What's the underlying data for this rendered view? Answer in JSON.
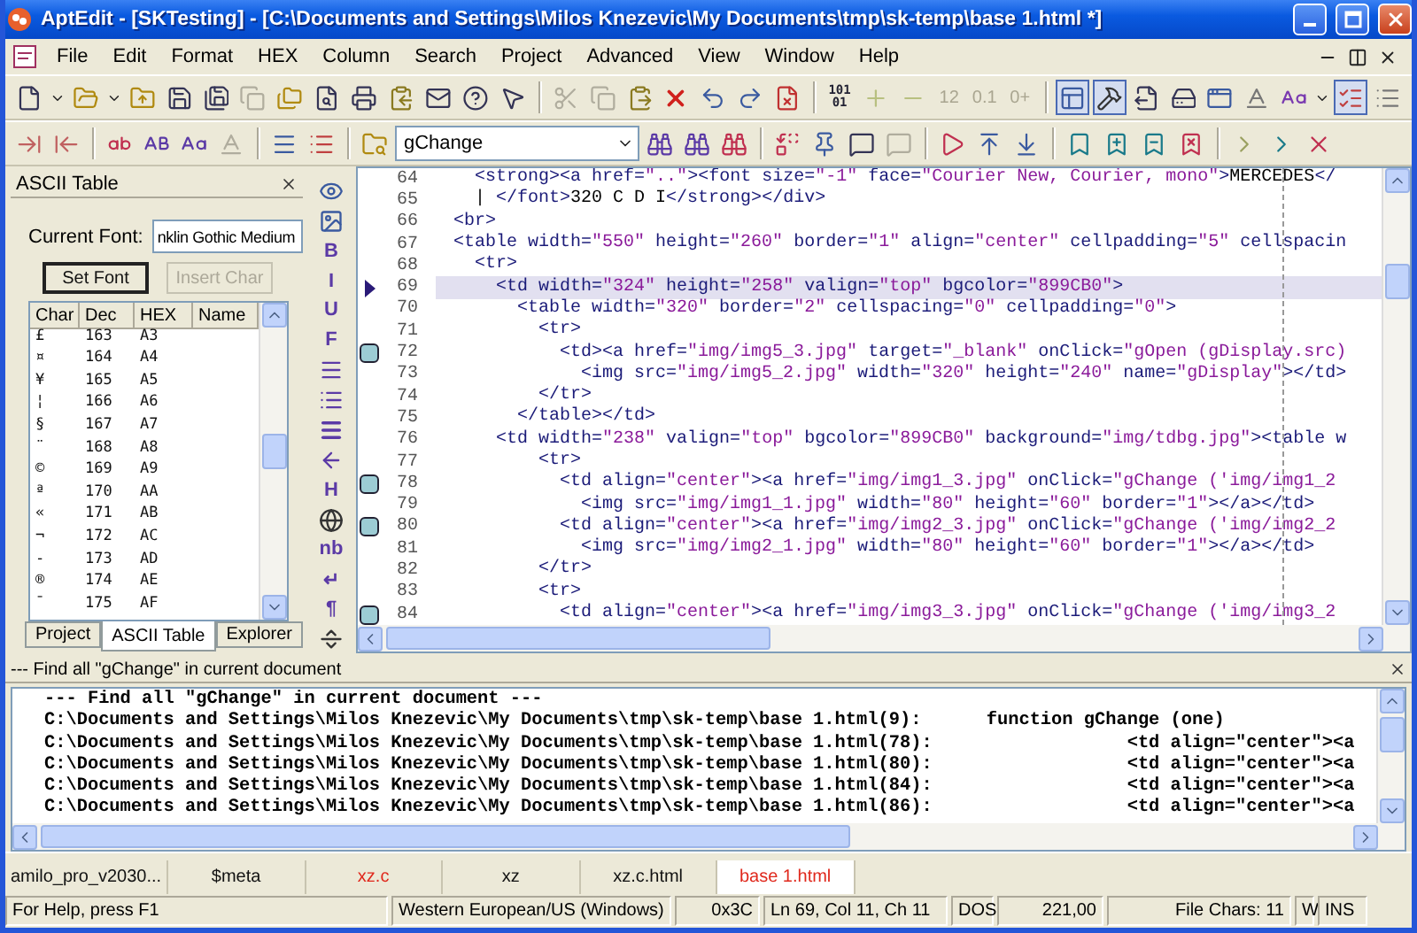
{
  "window": {
    "title": "AptEdit - [SKTesting] - [C:\\Documents and Settings\\Milos Knezevic\\My Documents\\tmp\\sk-temp\\base 1.html *]"
  },
  "menu": [
    "File",
    "Edit",
    "Format",
    "HEX",
    "Column",
    "Search",
    "Project",
    "Advanced",
    "View",
    "Window",
    "Help"
  ],
  "toolbar": {
    "hex_label": [
      "101",
      "01"
    ],
    "number_buttons": [
      {
        "label": "12",
        "disabled": true
      },
      {
        "label": "0.1",
        "disabled": true
      },
      {
        "label": "0+",
        "disabled": true
      }
    ]
  },
  "search_box": {
    "value": "gChange"
  },
  "ascii_panel": {
    "title": "ASCII Table",
    "font_label": "Current Font:",
    "font_value": "nklin Gothic Medium",
    "buttons": [
      {
        "label": "Set Font",
        "disabled": false
      },
      {
        "label": "Insert Char",
        "disabled": true
      }
    ],
    "columns": [
      "Char",
      "Dec",
      "HEX",
      "Name"
    ],
    "rows": [
      [
        "£",
        "163",
        "A3"
      ],
      [
        "¤",
        "164",
        "A4"
      ],
      [
        "¥",
        "165",
        "A5"
      ],
      [
        "¦",
        "166",
        "A6"
      ],
      [
        "§",
        "167",
        "A7"
      ],
      [
        "¨",
        "168",
        "A8"
      ],
      [
        "©",
        "169",
        "A9"
      ],
      [
        "ª",
        "170",
        "AA"
      ],
      [
        "«",
        "171",
        "AB"
      ],
      [
        "¬",
        "172",
        "AC"
      ],
      [
        "-",
        "173",
        "AD"
      ],
      [
        "®",
        "174",
        "AE"
      ],
      [
        "¯",
        "175",
        "AF"
      ]
    ]
  },
  "panel_tabs": [
    {
      "label": "Project",
      "selected": false
    },
    {
      "label": "ASCII Table",
      "selected": true
    },
    {
      "label": "Explorer",
      "selected": false
    }
  ],
  "format_toolbar": [
    {
      "kind": "icon"
    },
    {
      "kind": "icon"
    },
    {
      "kind": "text",
      "label": "B"
    },
    {
      "kind": "text",
      "label": "I"
    },
    {
      "kind": "text",
      "label": "U"
    },
    {
      "kind": "text",
      "label": "F"
    },
    {
      "kind": "icon"
    },
    {
      "kind": "icon"
    },
    {
      "kind": "icon"
    },
    {
      "kind": "icon"
    },
    {
      "kind": "text",
      "label": "H"
    },
    {
      "kind": "icon"
    },
    {
      "kind": "text",
      "label": "nb"
    },
    {
      "kind": "text",
      "label": "↵"
    },
    {
      "kind": "text",
      "label": "¶"
    },
    {
      "kind": "icon"
    }
  ],
  "editor": {
    "lines": [
      {
        "number": "64",
        "text": "  <strong><a href=\"..\"><font size=\"-1\" face=\"Courier New, Courier, mono\">MERCEDES</",
        "bookmark": false,
        "current": false
      },
      {
        "number": "65",
        "text": "  | </font>320 C D I</strong></div>",
        "bookmark": false,
        "current": false
      },
      {
        "number": "66",
        "text": "<br>",
        "bookmark": false,
        "current": false
      },
      {
        "number": "67",
        "text": "<table width=\"550\" height=\"260\" border=\"1\" align=\"center\" cellpadding=\"5\" cellspacin",
        "bookmark": false,
        "current": false
      },
      {
        "number": "68",
        "text": "  <tr>",
        "bookmark": false,
        "current": false
      },
      {
        "number": "69",
        "text": "    <td width=\"324\" height=\"258\" valign=\"top\" bgcolor=\"899CB0\">",
        "bookmark": false,
        "current": true
      },
      {
        "number": "70",
        "text": "      <table width=\"320\" border=\"2\" cellspacing=\"0\" cellpadding=\"0\">",
        "bookmark": false,
        "current": false
      },
      {
        "number": "71",
        "text": "        <tr>",
        "bookmark": false,
        "current": false
      },
      {
        "number": "72",
        "text": "          <td><a href=\"img/img5_3.jpg\" target=\"_blank\" onClick=\"gOpen (gDisplay.src)",
        "bookmark": true,
        "current": false
      },
      {
        "number": "73",
        "text": "            <img src=\"img/img5_2.jpg\" width=\"320\" height=\"240\" name=\"gDisplay\"></td>",
        "bookmark": false,
        "current": false
      },
      {
        "number": "74",
        "text": "        </tr>",
        "bookmark": false,
        "current": false
      },
      {
        "number": "75",
        "text": "      </table></td>",
        "bookmark": false,
        "current": false
      },
      {
        "number": "76",
        "text": "    <td width=\"238\" valign=\"top\" bgcolor=\"899CB0\" background=\"img/tdbg.jpg\"><table w",
        "bookmark": false,
        "current": false
      },
      {
        "number": "77",
        "text": "        <tr>",
        "bookmark": false,
        "current": false
      },
      {
        "number": "78",
        "text": "          <td align=\"center\"><a href=\"img/img1_3.jpg\" onClick=\"gChange ('img/img1_2",
        "bookmark": true,
        "current": false
      },
      {
        "number": "79",
        "text": "            <img src=\"img/img1_1.jpg\" width=\"80\" height=\"60\" border=\"1\"></a></td>",
        "bookmark": false,
        "current": false
      },
      {
        "number": "80",
        "text": "          <td align=\"center\"><a href=\"img/img2_3.jpg\" onClick=\"gChange ('img/img2_2",
        "bookmark": true,
        "current": false
      },
      {
        "number": "81",
        "text": "            <img src=\"img/img2_1.jpg\" width=\"80\" height=\"60\" border=\"1\"></a></td>",
        "bookmark": false,
        "current": false
      },
      {
        "number": "82",
        "text": "        </tr>",
        "bookmark": false,
        "current": false
      },
      {
        "number": "83",
        "text": "        <tr>",
        "bookmark": false,
        "current": false
      },
      {
        "number": "84",
        "text": "          <td align=\"center\"><a href=\"img/img3_3.jpg\" onClick=\"gChange ('img/img3_2",
        "bookmark": true,
        "current": false
      }
    ]
  },
  "find_panel": {
    "title": "--- Find all \"gChange\" in current document",
    "heading": "--- Find all \"gChange\" in current document ---",
    "results": [
      {
        "location": "C:\\Documents and Settings\\Milos Knezevic\\My Documents\\tmp\\sk-temp\\base 1.html(9):",
        "match": "function gChange (one)"
      },
      {
        "location": "C:\\Documents and Settings\\Milos Knezevic\\My Documents\\tmp\\sk-temp\\base 1.html(78):",
        "match": "             <td align=\"center\"><a"
      },
      {
        "location": "C:\\Documents and Settings\\Milos Knezevic\\My Documents\\tmp\\sk-temp\\base 1.html(80):",
        "match": "             <td align=\"center\"><a"
      },
      {
        "location": "C:\\Documents and Settings\\Milos Knezevic\\My Documents\\tmp\\sk-temp\\base 1.html(84):",
        "match": "             <td align=\"center\"><a"
      },
      {
        "location": "C:\\Documents and Settings\\Milos Knezevic\\My Documents\\tmp\\sk-temp\\base 1.html(86):",
        "match": "             <td align=\"center\"><a"
      }
    ]
  },
  "doc_tabs": [
    {
      "label": "amilo_pro_v2030...",
      "selected": false,
      "modified": false
    },
    {
      "label": "$meta",
      "selected": false,
      "modified": false
    },
    {
      "label": "xz.c",
      "selected": false,
      "modified": true
    },
    {
      "label": "xz",
      "selected": false,
      "modified": false
    },
    {
      "label": "xz.c.html",
      "selected": false,
      "modified": false
    },
    {
      "label": "base 1.html",
      "selected": true,
      "modified": true
    }
  ],
  "status_bar": [
    {
      "text": "For Help, press F1",
      "kind": "wide"
    },
    {
      "text": "Western European/US (Windows)",
      "kind": "left"
    },
    {
      "text": "0x3C",
      "kind": "right"
    },
    {
      "text": "Ln 69, Col 11, Ch 11",
      "kind": "left"
    },
    {
      "text": "DOS",
      "kind": "left"
    },
    {
      "text": "221,00",
      "kind": "right"
    },
    {
      "text": "File Chars: 11",
      "kind": "right"
    },
    {
      "text": "W",
      "kind": "left"
    },
    {
      "text": "INS",
      "kind": "left"
    }
  ]
}
